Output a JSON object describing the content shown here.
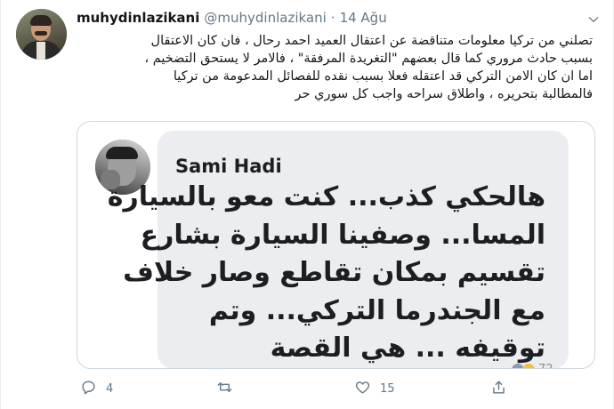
{
  "author": {
    "name": "muhydinlazikani",
    "handle": "@muhydinlazikani",
    "separator": "·",
    "time": "14 Ağu"
  },
  "tweet_lines": [
    "تصلني من تركيا معلومات متناقضة عن اعتقال العميد احمد رحال ، فان كان الاعتقال",
    "بسبب حادث مروري كما قال بعضهم \"التغريدة المرفقة\" ، فالامر لا يستحق التضخيم ،",
    "اما ان كان الامن التركي قد اعتقله فعلا بسبب نقده للفصائل المدعومة من تركيا",
    "فالمطالبة بتحريره ، واطلاق سراحه واجب كل سوري حر"
  ],
  "embedded": {
    "name": "Sami Hadi",
    "lines": [
      "هالحكي كذب... كنت معو بالسيارة",
      "المسا... وصفينا السيارة بشارع",
      "تقسيم بمكان تقاطع وصار خلاف",
      "مع الجندرما التركي... وتم",
      "توقيفه ... هي القصة"
    ],
    "reaction_count": "72"
  },
  "actions": {
    "reply_count": "4",
    "retweet_count": "",
    "like_count": "15"
  },
  "icons": {
    "menu": "chevron-down-icon",
    "reply": "reply-icon",
    "retweet": "retweet-icon",
    "like": "heart-icon",
    "share": "share-icon"
  },
  "colors": {
    "text": "#14171a",
    "muted": "#657786",
    "border": "#ccd6dd",
    "bubble": "#ebedf0"
  }
}
